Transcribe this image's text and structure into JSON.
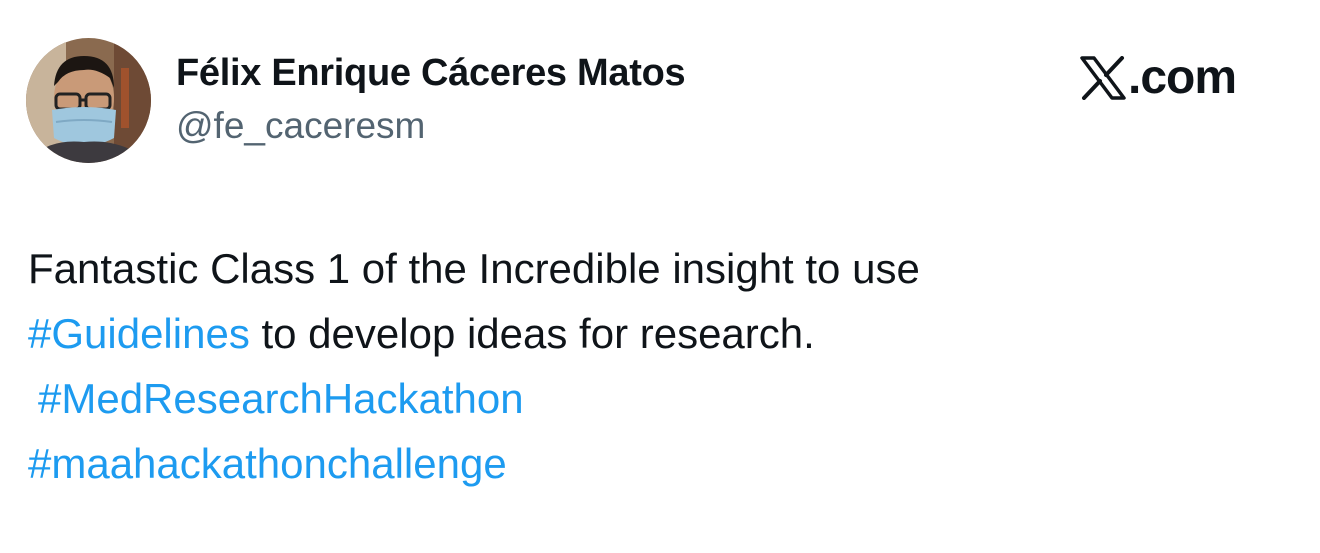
{
  "author": {
    "display_name": "Félix Enrique Cáceres Matos",
    "handle": "@fe_caceresm",
    "avatar_icon": "profile-photo"
  },
  "brand": {
    "icon": "x-logo-icon",
    "suffix": ".com"
  },
  "tweet": {
    "line1_text": "Fantastic Class 1 of the Incredible insight to use",
    "line2_hashtag": "#Guidelines",
    "line2_text": " to develop ideas for research.",
    "hashtag_med": "#MedResearchHackathon",
    "hashtag_maa": "#maahackathonchallenge"
  },
  "colors": {
    "text": "#0f1419",
    "secondary_text": "#536471",
    "link": "#1d9bf0",
    "background": "#ffffff"
  }
}
